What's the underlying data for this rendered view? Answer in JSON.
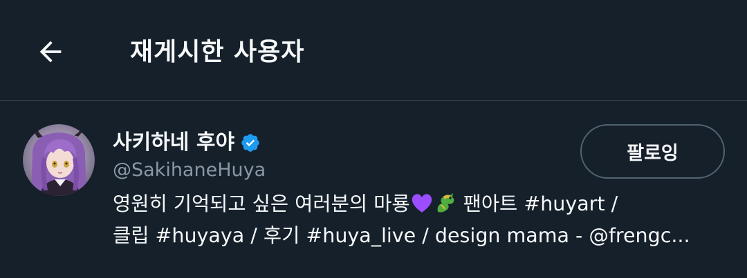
{
  "header": {
    "title": "재게시한 사용자"
  },
  "user": {
    "display_name": "사키하네 후야",
    "handle": "@SakihaneHuya",
    "follow_label": "팔로잉",
    "bio": {
      "line1_a": "영원히 기억되고 싶은 여러분의 마룡",
      "line1_b": " 팬아트 #huyart /",
      "line2": "클립 #huyaya / 후기 #huya_live / design mama - @frengc..."
    }
  },
  "icons": {
    "back": "arrow-left-icon",
    "verified": "verified-badge-icon",
    "heart": "purple-heart-emoji",
    "dragon": "dragon-emoji"
  },
  "colors": {
    "background": "#15202b",
    "text": "#f7f9f9",
    "muted": "#8b98a5",
    "border": "#38444d",
    "verified": "#1d9bf0",
    "heart": "#9b4dff"
  }
}
